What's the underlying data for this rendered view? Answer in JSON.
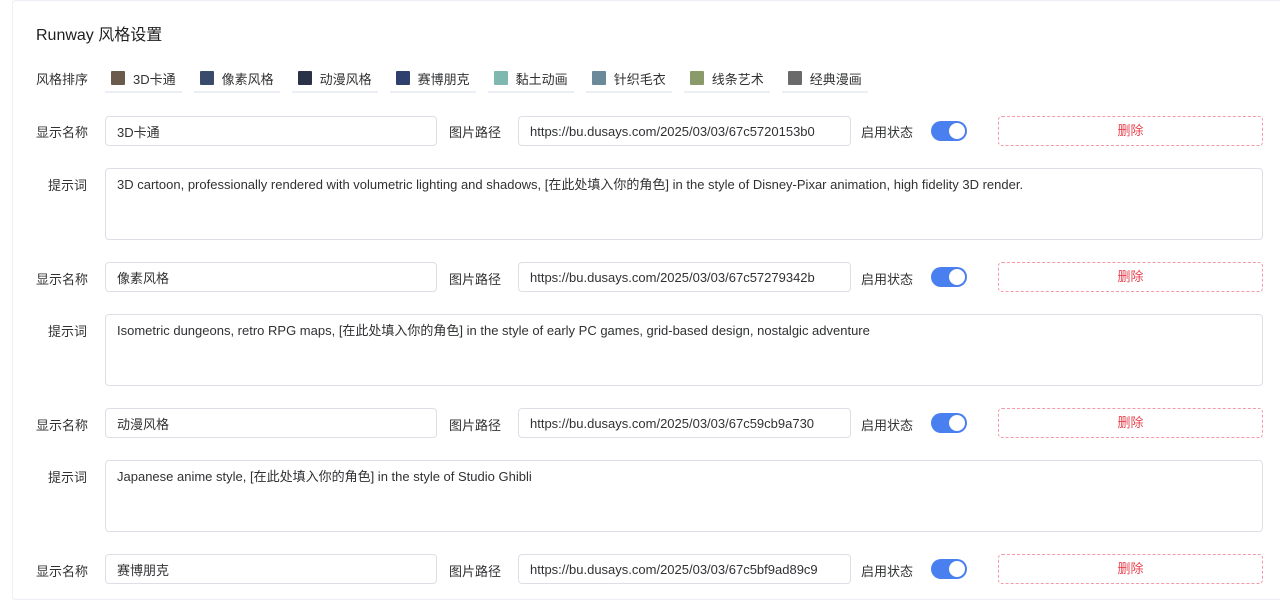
{
  "page": {
    "title": "Runway 风格设置",
    "order_label": "风格排序"
  },
  "order": [
    {
      "label": "3D卡通",
      "color": "#6b5b4a"
    },
    {
      "label": "像素风格",
      "color": "#3a4a6a"
    },
    {
      "label": "动漫风格",
      "color": "#2a3248"
    },
    {
      "label": "赛博朋克",
      "color": "#2f3f6e"
    },
    {
      "label": "黏土动画",
      "color": "#7fb8b0"
    },
    {
      "label": "针织毛衣",
      "color": "#6a8a9a"
    },
    {
      "label": "线条艺术",
      "color": "#8a9a6a"
    },
    {
      "label": "经典漫画",
      "color": "#6a6a6a"
    }
  ],
  "labels": {
    "name": "显示名称",
    "path": "图片路径",
    "status": "启用状态",
    "delete": "删除",
    "prompt": "提示词"
  },
  "styles": [
    {
      "name": "3D卡通",
      "path": "https://bu.dusays.com/2025/03/03/67c5720153b0",
      "enabled": true,
      "prompt": "3D cartoon, professionally rendered with volumetric lighting and shadows, [在此处填入你的角色] in the style of Disney-Pixar animation, high fidelity 3D render."
    },
    {
      "name": "像素风格",
      "path": "https://bu.dusays.com/2025/03/03/67c57279342b",
      "enabled": true,
      "prompt": "Isometric dungeons, retro RPG maps, [在此处填入你的角色] in the style of early PC games, grid-based design, nostalgic adventure"
    },
    {
      "name": "动漫风格",
      "path": "https://bu.dusays.com/2025/03/03/67c59cb9a730",
      "enabled": true,
      "prompt": "Japanese anime style, [在此处填入你的角色] in the style of Studio Ghibli"
    },
    {
      "name": "赛博朋克",
      "path": "https://bu.dusays.com/2025/03/03/67c5bf9ad89c9",
      "enabled": true,
      "prompt": ""
    }
  ],
  "colors": {
    "accent": "#4a7ff0",
    "danger": "#e6434f"
  }
}
